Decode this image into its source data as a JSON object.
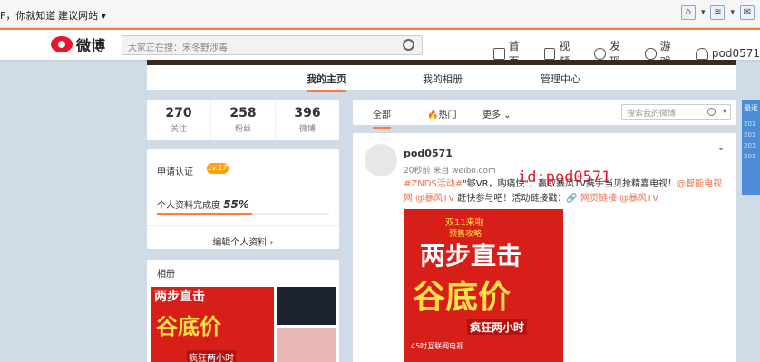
{
  "ie": {
    "left_text": "F，你就知道",
    "suggested_sites": "建议网站 ▾",
    "home_icon": "home-icon",
    "rss_icon": "rss-icon"
  },
  "top": {
    "logo": "微博",
    "search_placeholder": "大家正在搜：宋冬野涉毒",
    "nav": [
      "首页",
      "视频",
      "发现",
      "游戏",
      "pod0571"
    ]
  },
  "tabs": [
    "我的主页",
    "我的相册",
    "管理中心"
  ],
  "stats": [
    {
      "num": "270",
      "label": "关注"
    },
    {
      "num": "258",
      "label": "粉丝"
    },
    {
      "num": "396",
      "label": "微博"
    }
  ],
  "profile": {
    "apply_label": "申请认证",
    "level": "Lv.17",
    "completion_label": "个人资料完成度",
    "completion_value": "55%",
    "completion_fraction": 0.55,
    "edit_label": "编辑个人资料 ›"
  },
  "album": {
    "title": "相册",
    "thumb_top": "两步直击",
    "thumb_big": "谷底价",
    "thumb_sub": "疯狂两小时"
  },
  "feed": {
    "tab_all": "全部",
    "tab_hot": "🔥热门",
    "tab_more": "更多 ⌄",
    "search_placeholder": "搜索我的微博",
    "search_caret": "▾"
  },
  "post": {
    "author": "pod0571",
    "meta": "20秒前 来自 weibo.com",
    "text_hashtag": "#ZNDS活动#",
    "text_body": "\"够VR，购痛快\"，赢取暴风TV携手当贝抢精嘉电视！",
    "text_links": "@智能电视网 @暴风TV",
    "text_tail": " 赶快参与吧！活动链接戳：",
    "text_link2": "🔗 网页链接 @暴风TV",
    "watermark": "id:pod0571",
    "img_t1": "双11来啦",
    "img_t2": "预售攻略",
    "img_b1": "两步直击",
    "img_b2": "谷底价",
    "img_b3": "疯狂两小时",
    "img_b4": "45吋互联网电视"
  },
  "side": {
    "head": "最近",
    "years": [
      "201",
      "201",
      "201",
      "201"
    ]
  }
}
